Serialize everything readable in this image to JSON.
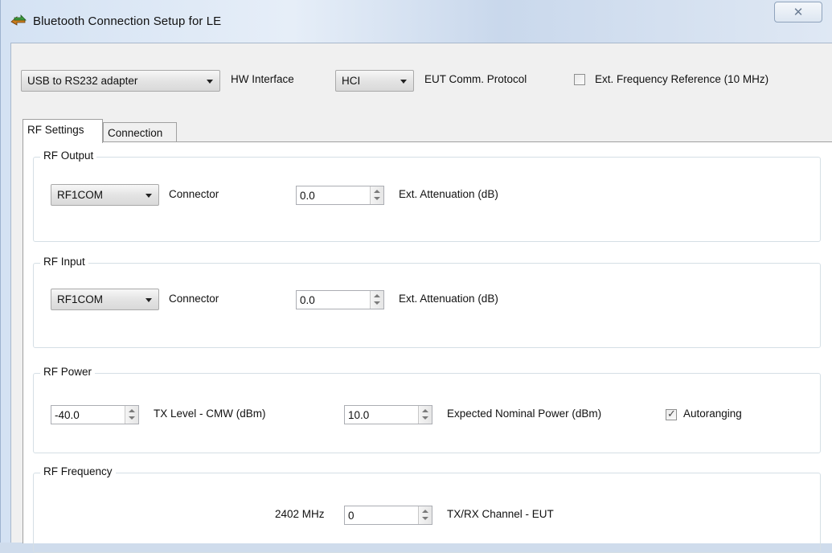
{
  "window": {
    "title": "Bluetooth Connection Setup for LE",
    "close_glyph": "✕"
  },
  "interface_bar": {
    "hw_interface_value": "USB to RS232 adapter",
    "hw_interface_label": "HW Interface",
    "protocol_value": "HCI",
    "protocol_label": "EUT Comm. Protocol",
    "ext_freq_label": "Ext. Frequency Reference (10 MHz)",
    "ext_freq_checked": false
  },
  "tabs": [
    {
      "label": "RF Settings",
      "active": true
    },
    {
      "label": "Connection",
      "active": false
    }
  ],
  "rf_output": {
    "title": "RF Output",
    "connector_value": "RF1COM",
    "connector_label": "Connector",
    "attenuation_value": "0.0",
    "attenuation_label": "Ext. Attenuation (dB)"
  },
  "rf_input": {
    "title": "RF Input",
    "connector_value": "RF1COM",
    "connector_label": "Connector",
    "attenuation_value": "0.0",
    "attenuation_label": "Ext. Attenuation (dB)"
  },
  "rf_power": {
    "title": "RF Power",
    "tx_level_value": "-40.0",
    "tx_level_label": "TX Level - CMW (dBm)",
    "expected_power_value": "10.0",
    "expected_power_label": "Expected Nominal Power (dBm)",
    "autoranging_label": "Autoranging",
    "autoranging_checked": true,
    "check_glyph": "✓"
  },
  "rf_frequency": {
    "title": "RF Frequency",
    "freq_readout": "2402 MHz",
    "channel_value": "0",
    "channel_label": "TX/RX Channel - EUT"
  },
  "colors": {
    "title_bar": "#dae5f2",
    "panel": "#ffffff",
    "client": "#f0f0f0",
    "group_border": "#d5dfe5"
  },
  "icons": {
    "app": "bluetooth-arrows-icon",
    "close": "close-icon",
    "combo": "chevron-down-icon",
    "spin": "spin-arrows-icon"
  }
}
